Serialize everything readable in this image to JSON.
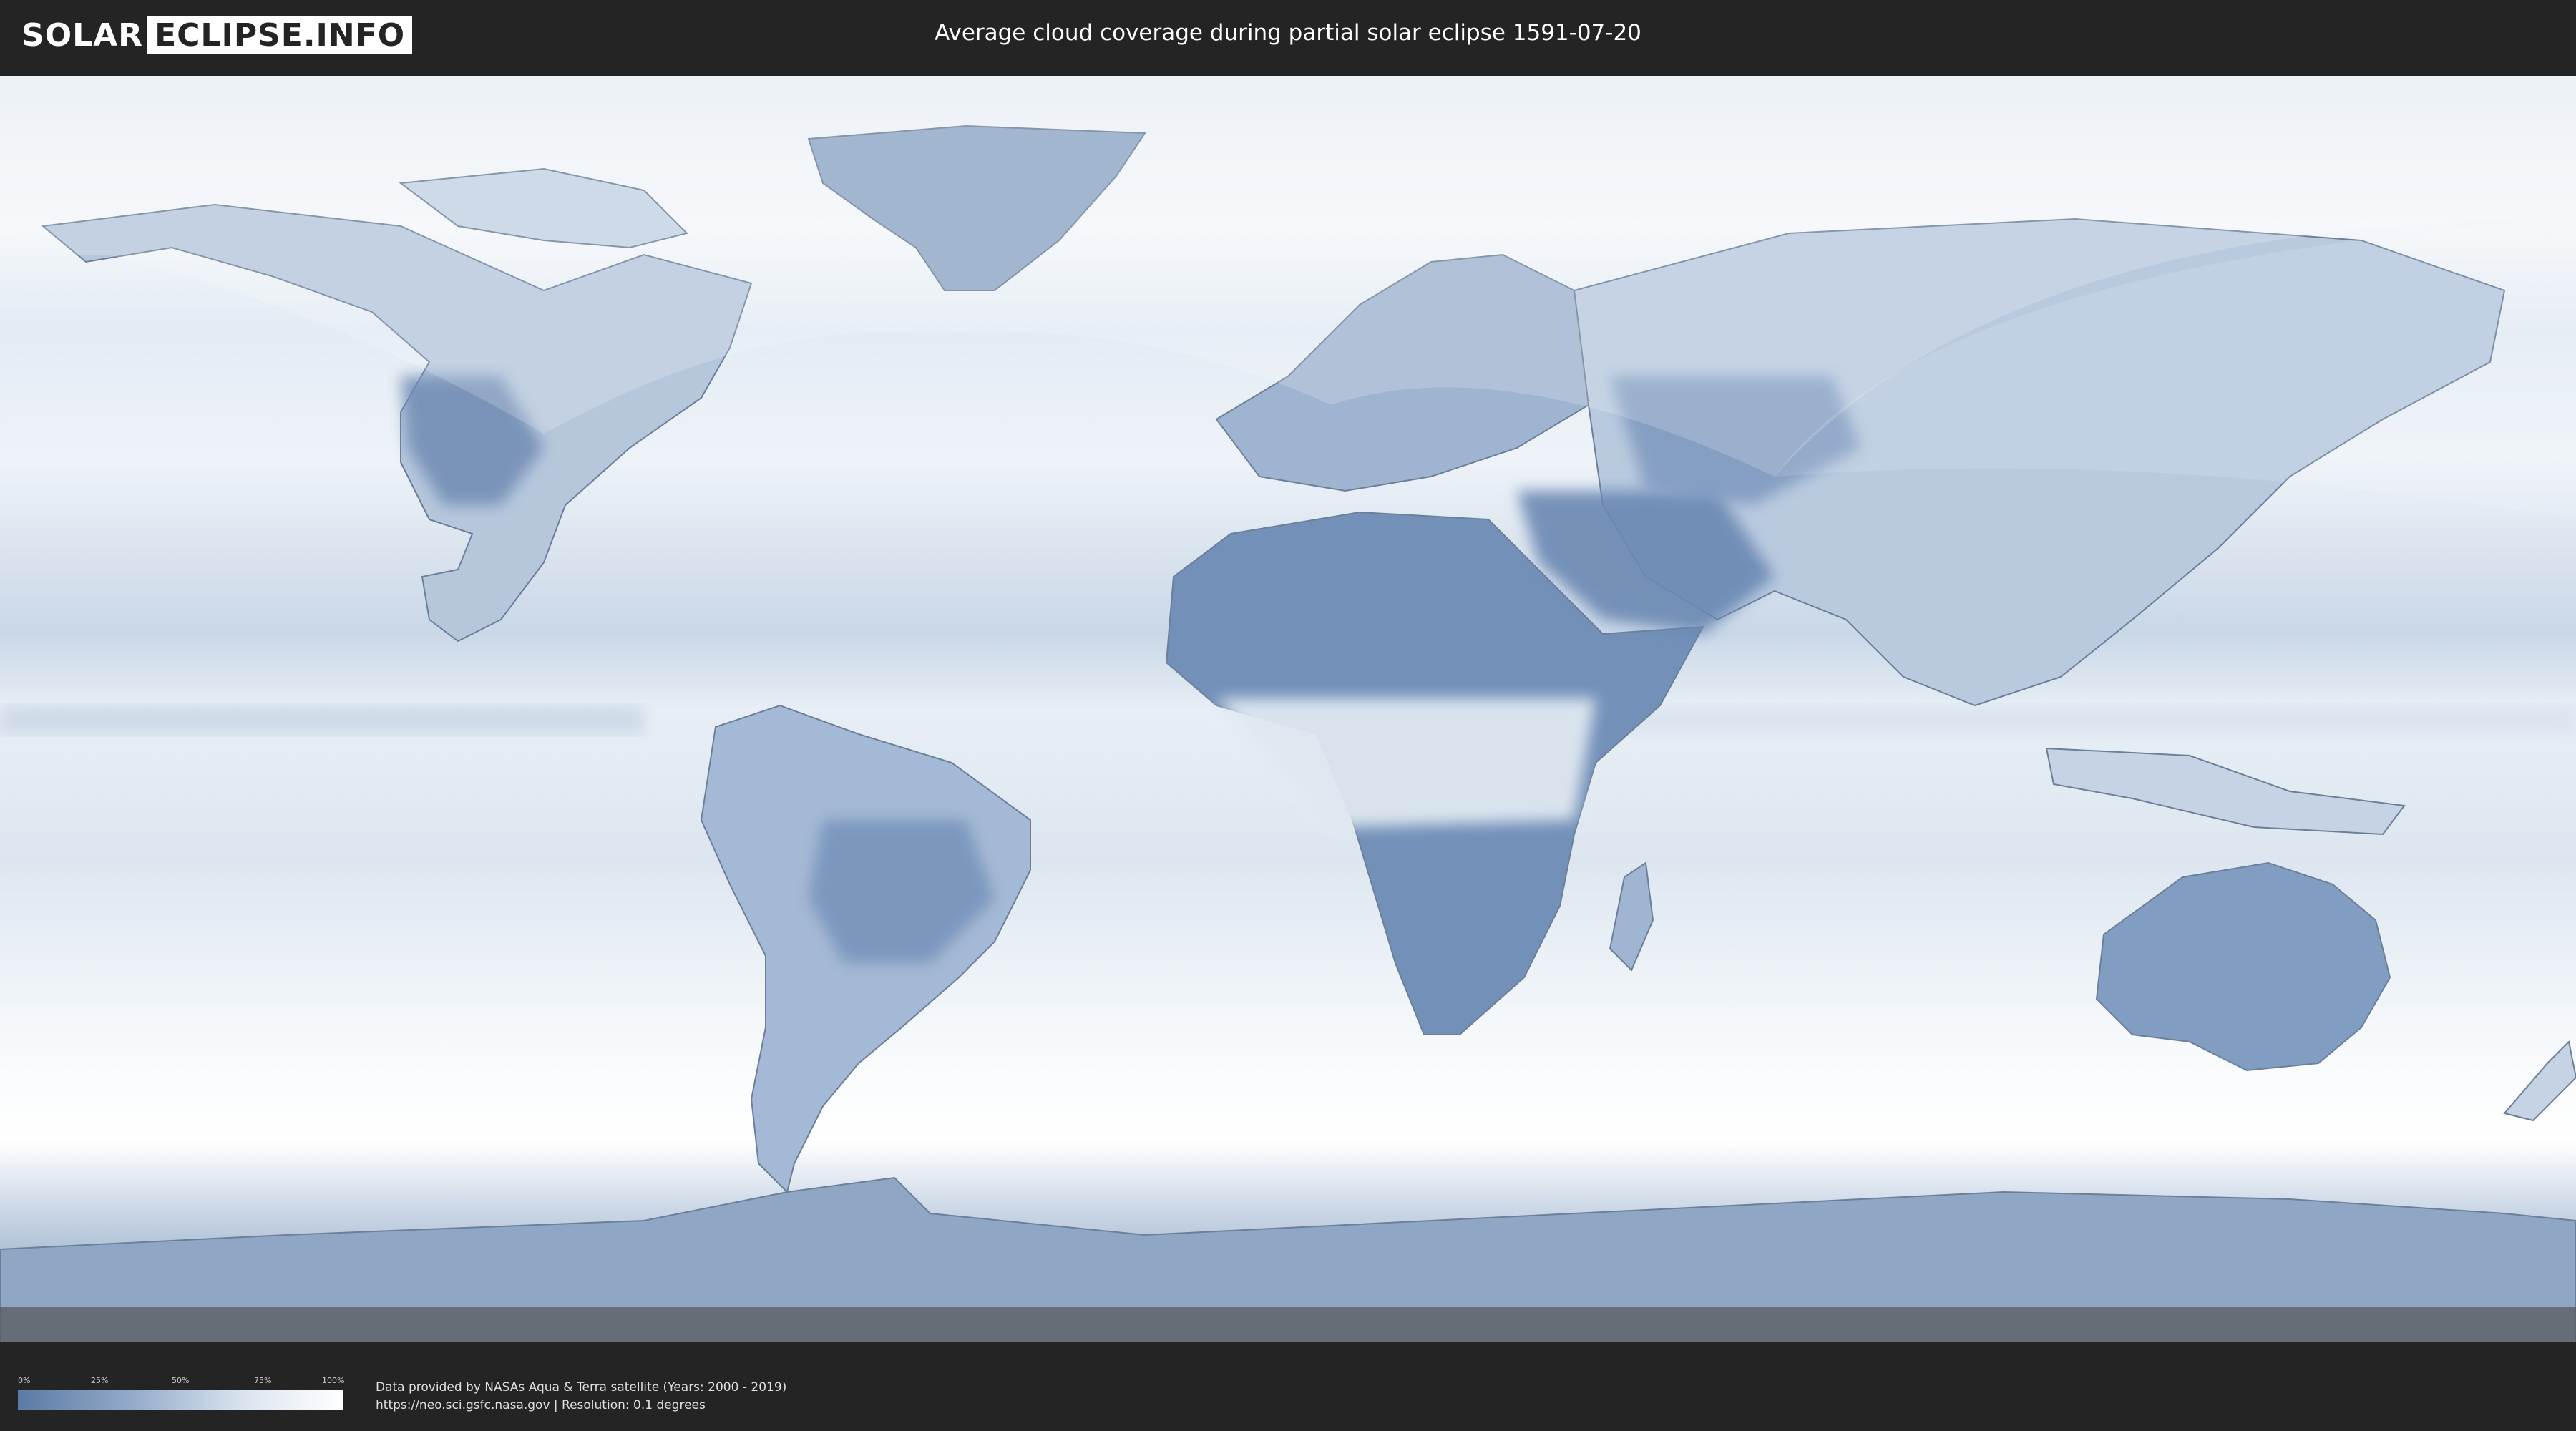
{
  "header": {
    "logo_part1": "SOLAR",
    "logo_part2": "ECLIPSE.INFO",
    "title": "Average cloud coverage during partial solar eclipse 1591-07-20"
  },
  "map": {
    "kind": "equirectangular world map",
    "shaded_region": "partial eclipse visibility zones (lighter overlay)",
    "colors": {
      "ocean_cloudy": "#f2f6fa",
      "clear_sky": "#5d7ca6",
      "mid": "#9fb5d1",
      "land_outline": "#6b7f99",
      "overlay": "#ffffff"
    }
  },
  "legend": {
    "ticks": [
      "0%",
      "25%",
      "50%",
      "75%",
      "100%"
    ],
    "gradient_colors": [
      "#5b7aa5",
      "#93abca",
      "#dbe5f0",
      "#ffffff"
    ]
  },
  "credits": {
    "line1": "Data provided by NASAs Aqua & Terra satellite (Years: 2000 - 2019)",
    "line2": "https://neo.sci.gsfc.nasa.gov | Resolution: 0.1 degrees"
  }
}
